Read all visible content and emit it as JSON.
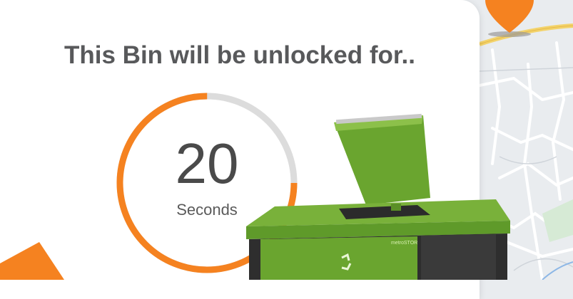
{
  "timer": {
    "title": "This Bin will be unlocked for..",
    "seconds_value": "20",
    "seconds_unit": "Seconds",
    "remaining_fraction": 0.75
  },
  "bin": {
    "brand": "metroSTOR",
    "icon": "recycle-icon"
  },
  "map": {
    "pin_icon": "map-pin-icon"
  },
  "colors": {
    "accent_orange": "#f58220",
    "ring_track": "#dcdcdc",
    "bin_green": "#6aa52f",
    "title_gray": "#58595b",
    "map_background": "#e9ecef",
    "road_yellow": "#f3d36b"
  }
}
